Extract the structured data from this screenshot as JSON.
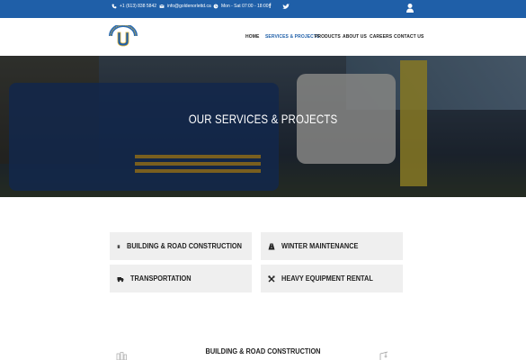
{
  "topbar": {
    "phone": "+1 (613) 838 5842",
    "email": "info@goldenorlettd.ca",
    "hours": "Mon - Sat 07:00 - 18:00",
    "facebook_label": "f",
    "twitter_label": "t"
  },
  "header": {
    "nav": [
      {
        "label": "HOME"
      },
      {
        "label": "SERVICES & PROJECTS"
      },
      {
        "label": "PRODUCTS"
      },
      {
        "label": "ABOUT US"
      },
      {
        "label": "CAREERS"
      },
      {
        "label": "CONTACT US"
      }
    ]
  },
  "hero": {
    "title": "OUR SERVICES & PROJECTS"
  },
  "services": [
    {
      "label": "BUILDING & ROAD CONSTRUCTION",
      "icon": "building-icon"
    },
    {
      "label": "WINTER MAINTENANCE",
      "icon": "road-icon"
    },
    {
      "label": "TRANSPORTATION",
      "icon": "truck-icon"
    },
    {
      "label": "HEAVY EQUIPMENT RENTAL",
      "icon": "tools-icon"
    }
  ],
  "section": {
    "title": "BUILDING & ROAD CONSTRUCTION"
  },
  "colors": {
    "topbar": "#1f5fa8",
    "active_nav": "#1f5fa8",
    "card_bg": "#efefef"
  }
}
